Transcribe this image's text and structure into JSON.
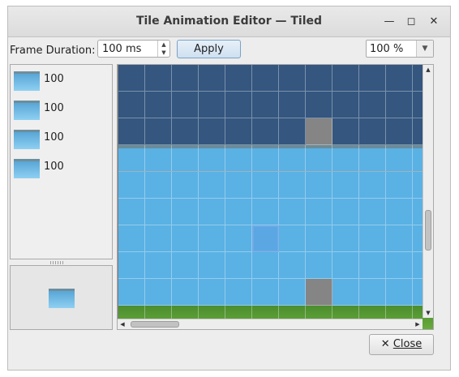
{
  "window": {
    "title": "Tile Animation Editor — Tiled",
    "controls": {
      "minimize": "—",
      "maximize": "◻",
      "close": "✕"
    }
  },
  "toolbar": {
    "frame_duration_label": "Frame Duration:",
    "frame_duration_value": "100 ms",
    "apply_label": "Apply",
    "zoom_value": "100 %"
  },
  "frames": [
    {
      "duration": "100"
    },
    {
      "duration": "100"
    },
    {
      "duration": "100"
    },
    {
      "duration": "100"
    }
  ],
  "footer": {
    "close_label": "Close",
    "close_mnemonic": "C"
  },
  "colors": {
    "night_water": "#34567f",
    "water": "#5ab1e4",
    "floor_gray": "#858585",
    "grass": "#5c9e36"
  },
  "tileset_grid": [
    "nnnnnnnnnnnn",
    "nnnnnnnnnnnn",
    "nnnnnnngnnnn",
    "TTTTTTTTTTTT",
    "WWWWWWWWWWWW",
    "WWWWWWWWWWWW",
    "WWWWWSWWWWWW",
    "WWWWWWWWWWWW",
    "WWWWWWWgWWWW",
    "GGGGGGGGGGGG"
  ]
}
